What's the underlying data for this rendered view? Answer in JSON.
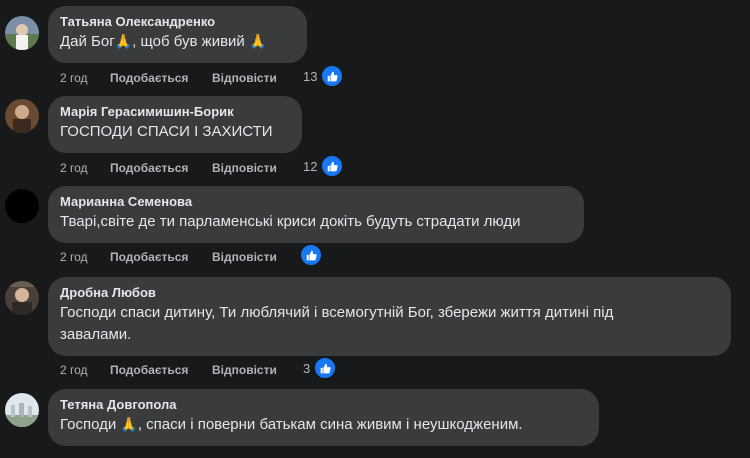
{
  "comments": [
    {
      "author": "Татьяна Олександренко",
      "text_before": "Дай Бог",
      "emoji_1": "🙏",
      "text_after": ", щоб був живий ",
      "emoji_2": "🙏",
      "time": "2 год",
      "like_label": "Подобається",
      "reply_label": "Відповісти",
      "reaction_count": "13",
      "reaction_icon": "thumbs-up-icon"
    },
    {
      "author": "Марія Герасимишин-Борик",
      "text": "ГОСПОДИ СПАСИ І ЗАХИСТИ",
      "time": "2 год",
      "like_label": "Подобається",
      "reply_label": "Відповісти",
      "reaction_count": "12",
      "reaction_icon": "thumbs-up-icon"
    },
    {
      "author": "Марианна Семенова",
      "text": "Тварі,світе де ти парламенські криси докіть будуть страдати люди",
      "time": "2 год",
      "like_label": "Подобається",
      "reply_label": "Відповісти",
      "reaction_count": "",
      "reaction_icon": "thumbs-up-icon"
    },
    {
      "author": "Дробна Любов",
      "text_line_1": "Господи спаси дитину, Ти люблячий і всемогутній Бог, збережи життя дитині під",
      "text_line_2": "завалами.",
      "time": "2 год",
      "like_label": "Подобається",
      "reply_label": "Відповісти",
      "reaction_count": "3",
      "reaction_icon": "thumbs-up-icon"
    },
    {
      "author": "Тетяна Довгопола",
      "text_before": "Господи ",
      "emoji_1": "🙏",
      "text_after": ", спаси і поверни батькам сина живим і неушкодженим.",
      "time": "",
      "like_label": "",
      "reply_label": ""
    }
  ],
  "colors": {
    "background": "#18191a",
    "bubble": "#3a3b3c",
    "text": "#e4e6eb",
    "meta": "#b0b3b8",
    "like_blue": "#1877f2"
  }
}
